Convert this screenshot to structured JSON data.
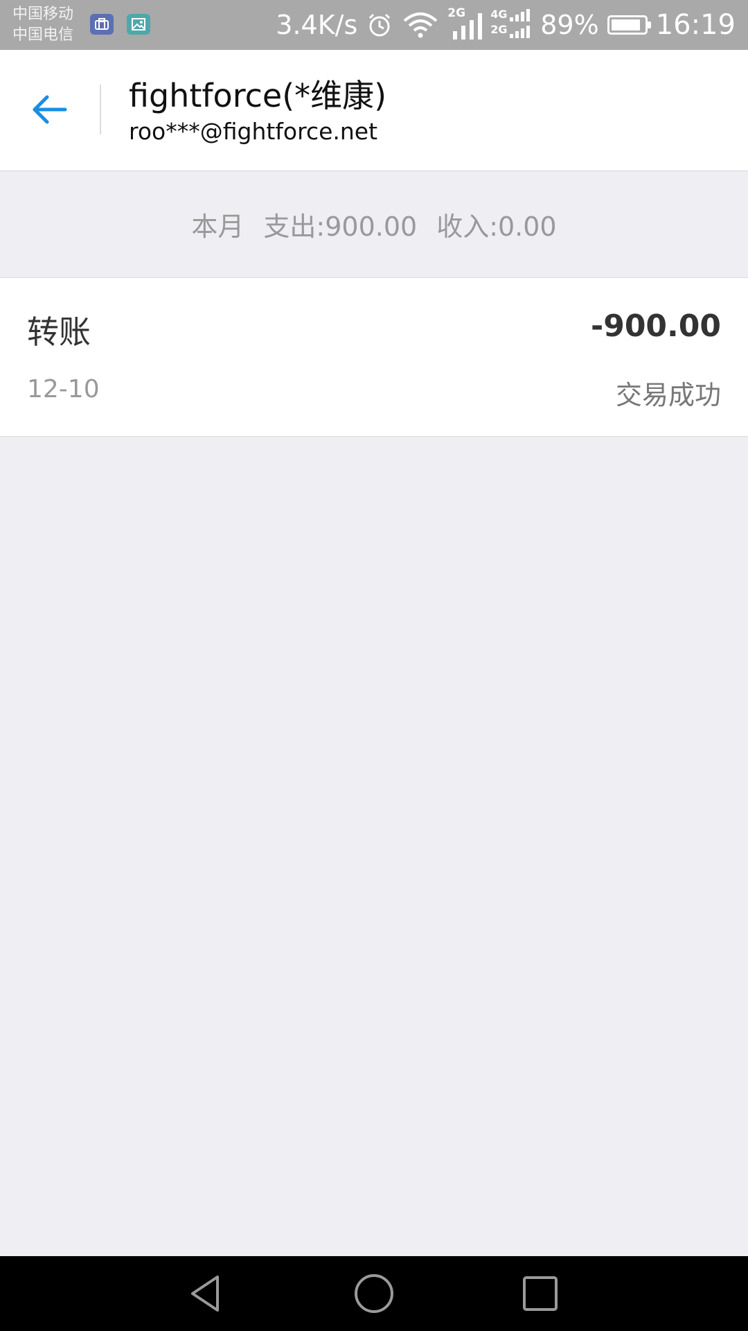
{
  "status_bar": {
    "carrier_1": "中国移动",
    "carrier_2": "中国电信",
    "network_speed": "3.4K/s",
    "signal_1_label": "2G",
    "signal_2_label_top": "4G",
    "signal_2_label_bottom": "2G",
    "battery_percent": "89%",
    "battery_level": 0.89,
    "time": "16:19",
    "icons": [
      "briefcase-icon",
      "image-icon",
      "alarm-icon",
      "wifi-icon",
      "signal-icon",
      "battery-icon"
    ]
  },
  "header": {
    "back_icon": "arrow-left-icon",
    "title": "fightforce(*维康)",
    "subtitle": "roo***@fightforce.net",
    "accent_color": "#1a8ee1"
  },
  "summary": {
    "period": "本月",
    "expense": "支出:900.00",
    "income": "收入:0.00"
  },
  "transactions": [
    {
      "type": "转账",
      "amount": "-900.00",
      "date": "12-10",
      "status": "交易成功"
    }
  ],
  "nav_bar": {
    "icons": [
      "nav-back-icon",
      "nav-home-icon",
      "nav-recent-icon"
    ]
  }
}
